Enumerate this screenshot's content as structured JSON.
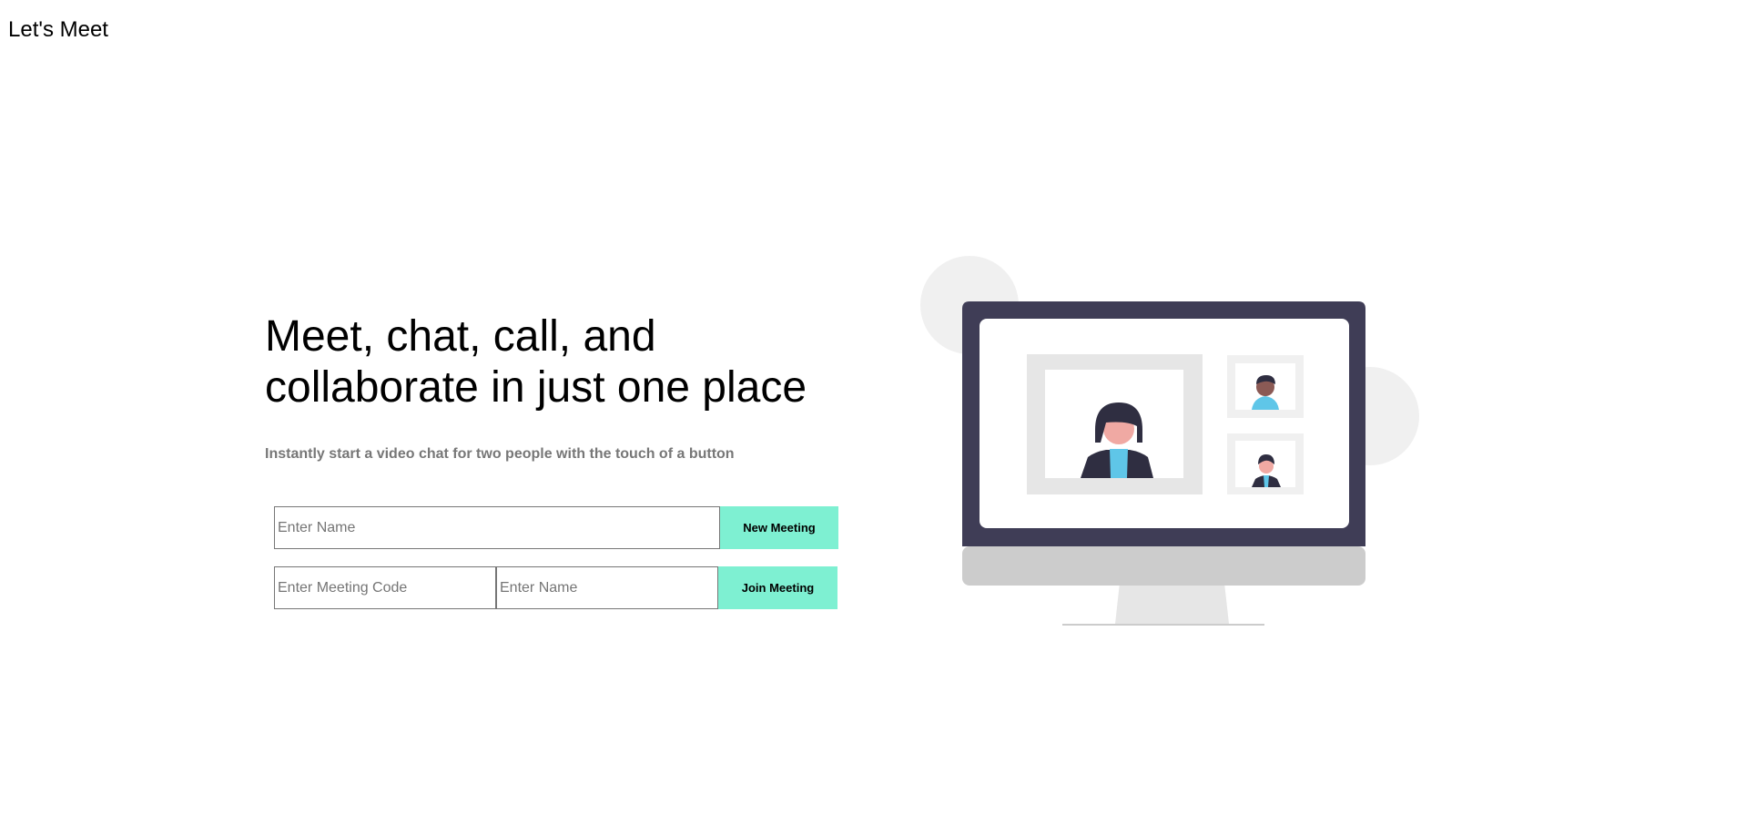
{
  "header": {
    "brand": "Let's Meet"
  },
  "hero": {
    "headline": "Meet, chat, call, and collaborate in just one place",
    "subtext": "Instantly start a video chat for two people with the touch of a button"
  },
  "new_meeting": {
    "name_placeholder": "Enter Name",
    "button_label": "New Meeting"
  },
  "join_meeting": {
    "code_placeholder": "Enter Meeting Code",
    "name_placeholder": "Enter Name",
    "button_label": "Join Meeting"
  },
  "colors": {
    "accent": "#7ef0d2",
    "monitor_frame": "#3f3d56",
    "monitor_stand": "#cccccc",
    "avatar_blue": "#5fc6e8"
  },
  "illustration": {
    "icon": "video-conference-monitor-illustration"
  }
}
